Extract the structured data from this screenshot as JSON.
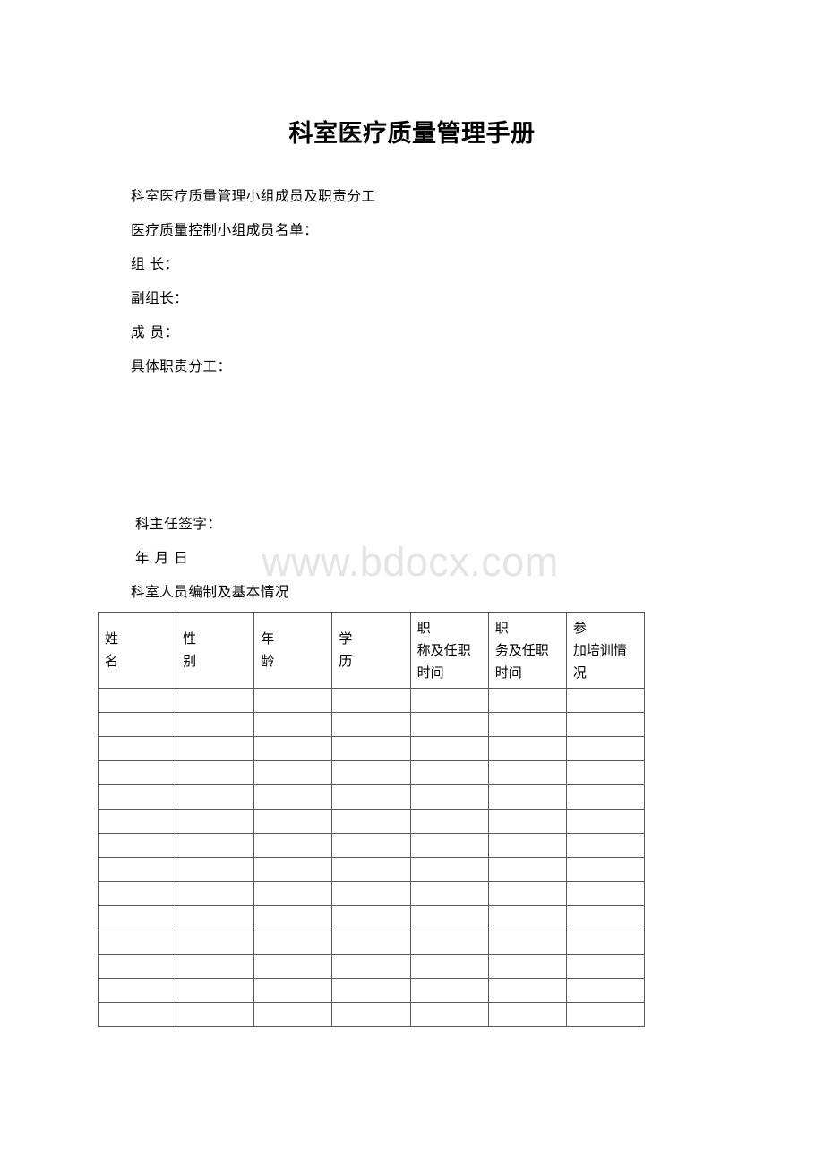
{
  "document": {
    "title": "科室医疗质量管理手册",
    "watermark": "www.bdocx.com"
  },
  "body_lines": [
    "科室医疗质量管理小组成员及职责分工",
    "医疗质量控制小组成员名单：",
    "组 长：",
    "副组长：",
    "成 员：",
    "具体职责分工："
  ],
  "signature_lines": [
    "科主任签字：",
    "年 月 日",
    "科室人员编制及基本情况"
  ],
  "table": {
    "headers": [
      {
        "lead": "姓",
        "tail": "名"
      },
      {
        "lead": "性",
        "tail": "别"
      },
      {
        "lead": "年",
        "tail": "龄"
      },
      {
        "lead": "学",
        "tail": "历"
      },
      {
        "lead": "职",
        "tail": "称及任职时间"
      },
      {
        "lead": "职",
        "tail": "务及任职时间"
      },
      {
        "lead": "参",
        "tail": "加培训情况"
      }
    ],
    "empty_row_count": 14,
    "column_count": 7,
    "border_color": "#575757"
  }
}
